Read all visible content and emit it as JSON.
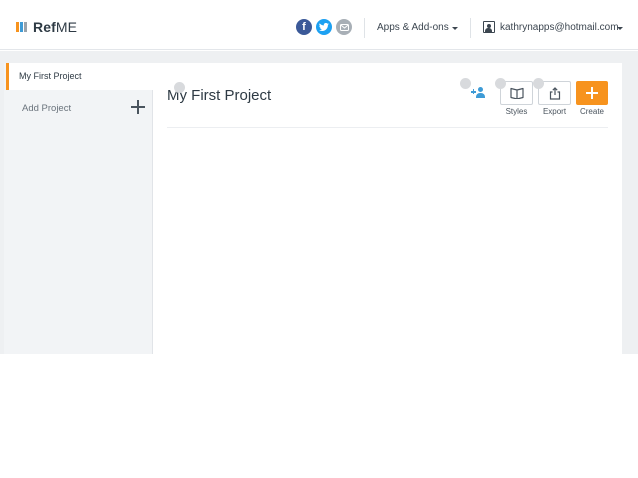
{
  "brand": {
    "name_bold": "Ref",
    "name_light": "ME",
    "bar_colors": [
      "#f7931e",
      "#3e9bd6",
      "#9aa3ab"
    ]
  },
  "header": {
    "social": [
      {
        "icon": "facebook-icon",
        "glyph": "f",
        "color": "#3b5998"
      },
      {
        "icon": "twitter-icon",
        "color": "#1da1f2"
      },
      {
        "icon": "email-icon",
        "color": "#a8afb6"
      }
    ],
    "apps_label": "Apps & Add-ons",
    "user_email": "kathrynapps@hotmail.com"
  },
  "sidebar": {
    "active_project": "My First Project",
    "add_project_label": "Add Project"
  },
  "main": {
    "project_title": "My First Project",
    "tools": {
      "styles_label": "Styles",
      "export_label": "Export",
      "create_label": "Create"
    }
  },
  "colors": {
    "accent": "#f7931e",
    "link_blue": "#3e9bd6"
  }
}
